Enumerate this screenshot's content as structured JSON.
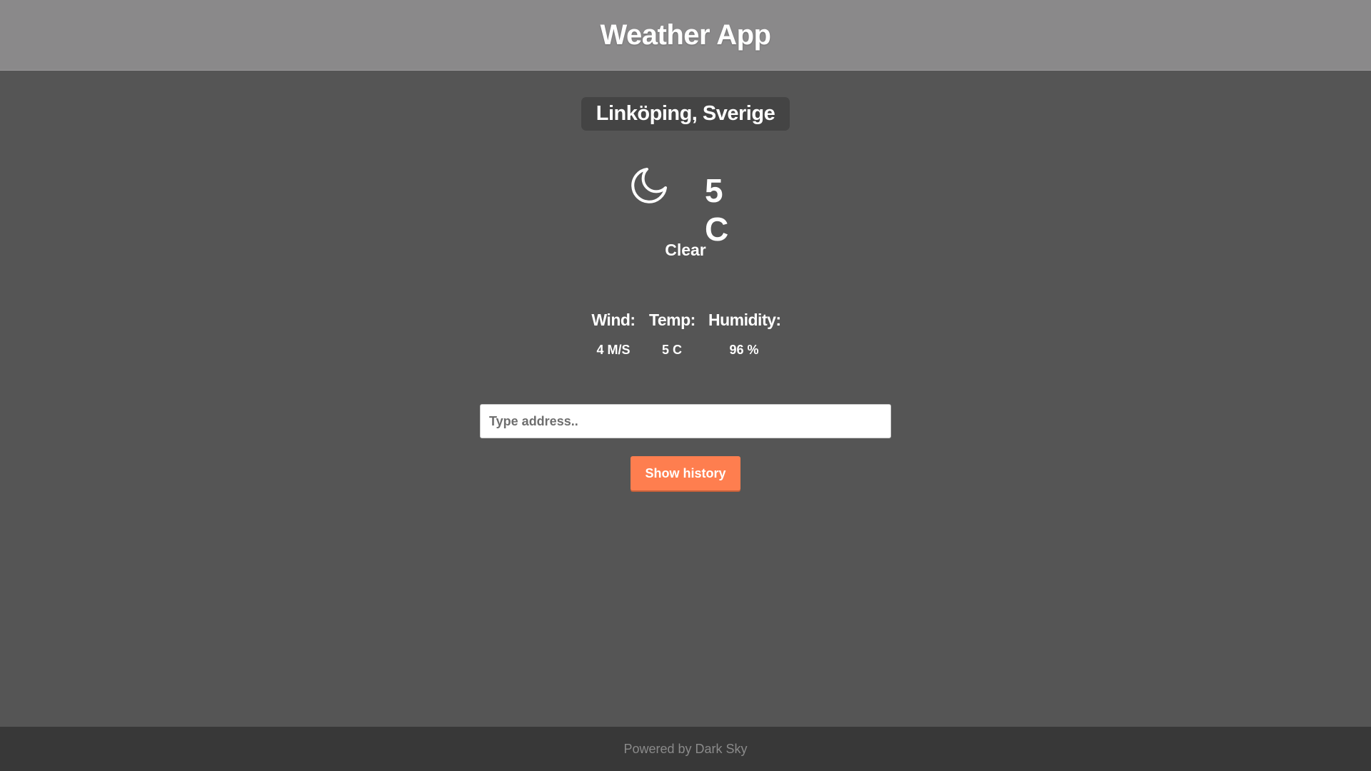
{
  "header": {
    "title": "Weather App"
  },
  "location": {
    "name": "Linköping, Sverige"
  },
  "current": {
    "icon": "moon-icon",
    "temperature": "5 C",
    "summary": "Clear"
  },
  "stats": {
    "wind": {
      "label": "Wind:",
      "value": "4 M/S"
    },
    "temp": {
      "label": "Temp:",
      "value": "5 C"
    },
    "humidity": {
      "label": "Humidity:",
      "value": "96 %"
    }
  },
  "search": {
    "placeholder": "Type address..",
    "value": ""
  },
  "history_button": {
    "label": "Show history"
  },
  "footer": {
    "text": "Powered by Dark Sky"
  },
  "colors": {
    "header_bg": "#8a898a",
    "body_bg": "#555555",
    "location_bg": "#444444",
    "button_bg": "#fe7e4f",
    "footer_bg": "#383838",
    "footer_text": "#8a8a8a"
  }
}
